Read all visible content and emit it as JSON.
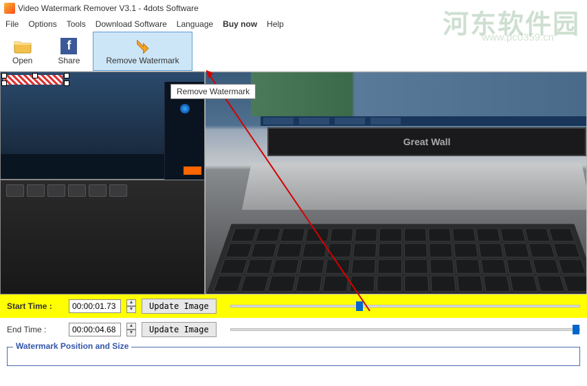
{
  "window": {
    "title": "Video Watermark Remover V3.1 - 4dots Software"
  },
  "menu": {
    "file": "File",
    "options": "Options",
    "tools": "Tools",
    "download": "Download Software",
    "language": "Language",
    "buynow": "Buy now",
    "help": "Help"
  },
  "toolbar": {
    "open": "Open",
    "share": "Share",
    "remove": "Remove Watermark"
  },
  "tooltip": {
    "remove": "Remove Watermark"
  },
  "preview": {
    "monitor_brand": "Great Wall"
  },
  "startRow": {
    "label": "Start Time :",
    "value": "00:00:01.73",
    "update": "Update Image",
    "sliderPercent": 36
  },
  "endRow": {
    "label": "End Time :",
    "value": "00:00:04.68",
    "update": "Update Image",
    "sliderPercent": 100
  },
  "group": {
    "title": "Watermark Position and Size"
  },
  "site": {
    "name": "河东软件园",
    "url": "www.pc0359.cn"
  }
}
